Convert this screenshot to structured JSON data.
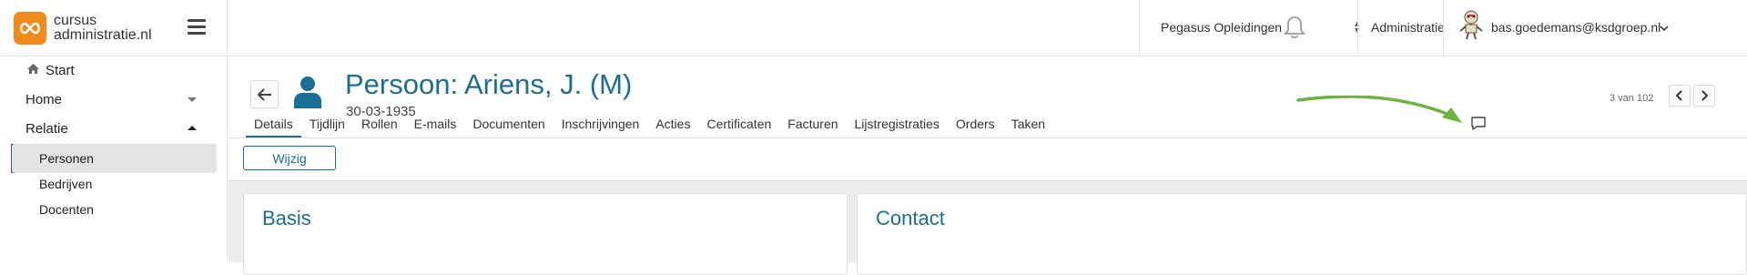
{
  "app": {
    "logo_line1": "cursus",
    "logo_line2": "administratie.nl"
  },
  "topbar": {
    "organisation": "Pegasus Opleidingen",
    "section": "Administratie",
    "user_email": "bas.goedemans@ksdgroep.nl"
  },
  "sidebar": {
    "items": [
      {
        "label": "Start"
      },
      {
        "label": "Home"
      },
      {
        "label": "Relatie"
      }
    ],
    "sub_items": [
      {
        "label": "Personen"
      },
      {
        "label": "Bedrijven"
      },
      {
        "label": "Docenten"
      }
    ]
  },
  "record": {
    "title": "Persoon: Ariens, J. (M)",
    "date": "30-03-1935",
    "pager": "3 van 102"
  },
  "tabs": [
    {
      "label": "Details"
    },
    {
      "label": "Tijdlijn"
    },
    {
      "label": "Rollen"
    },
    {
      "label": "E-mails"
    },
    {
      "label": "Documenten"
    },
    {
      "label": "Inschrijvingen"
    },
    {
      "label": "Acties"
    },
    {
      "label": "Certificaten"
    },
    {
      "label": "Facturen"
    },
    {
      "label": "Lijstregistraties"
    },
    {
      "label": "Orders"
    },
    {
      "label": "Taken"
    }
  ],
  "actions": {
    "edit_label": "Wijzig"
  },
  "cards": [
    {
      "title": "Basis"
    },
    {
      "title": "Contact"
    }
  ],
  "colors": {
    "brand": "#1a6e96",
    "logo": "#f28a1a",
    "annotation_arrow": "#6db33f"
  }
}
